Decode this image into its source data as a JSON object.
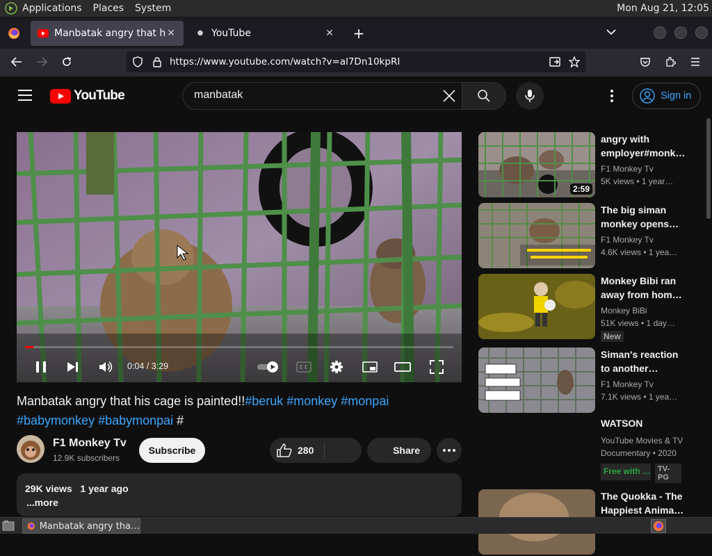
{
  "system_panel": {
    "menus": [
      "Applications",
      "Places",
      "System"
    ],
    "clock": "Mon Aug 21, 12:05"
  },
  "browser": {
    "tabs": [
      {
        "title": "Manbatak angry that his cage is painted",
        "active": true
      },
      {
        "title": "YouTube",
        "active": false
      }
    ],
    "url": "https://www.youtube.com/watch?v=al7Dn10kpRI"
  },
  "youtube": {
    "logo_text": "YouTube",
    "search_value": "manbatak",
    "sign_in_label": "Sign in",
    "player": {
      "current_time": "0:04",
      "duration": "3:29",
      "progress_fraction": 0.02
    },
    "video": {
      "title_plain": "Manbatak angry that his cage is painted!!",
      "hashtags_line1": "#beruk #monkey #monpai",
      "hashtags_line2": "#babymonkey #babymonpai",
      "title_trailing": "#",
      "channel_name": "F1 Monkey Tv",
      "subscribers": "12.9K subscribers",
      "subscribe_label": "Subscribe",
      "like_count": "280",
      "share_label": "Share",
      "views": "29K views",
      "age": "1 year ago",
      "more_label": "...more"
    },
    "recommendations": [
      {
        "title_line1": "angry with",
        "title_line2": "employer#monk…",
        "channel": "F1 Monkey Tv",
        "meta": "5K views  • 1 year…",
        "duration": "2:59",
        "badge": ""
      },
      {
        "title_line1": "The big siman",
        "title_line2": "monkey opens…",
        "channel": "F1 Monkey Tv",
        "meta": "4.6K views  • 1 yea…",
        "duration": "",
        "badge": ""
      },
      {
        "title_line1": "Monkey Bibi ran",
        "title_line2": "away from hom…",
        "channel": "Monkey BiBi",
        "meta": "51K views  • 1 day…",
        "duration": "",
        "badge": "New"
      },
      {
        "title_line1": "Siman's reaction",
        "title_line2": "to another…",
        "channel": "F1 Monkey Tv",
        "meta": "7.1K views  • 1 yea…",
        "duration": "",
        "badge": ""
      }
    ],
    "movie": {
      "title": "WATSON",
      "line1": "YouTube Movies & TV",
      "line2": "Documentary • 2020",
      "free_label": "Free with …",
      "rating": "TV-PG"
    },
    "last_rec": {
      "title_line1": "The Quokka - The",
      "title_line2": "Happiest Anima…"
    }
  },
  "taskbar": {
    "window_title": "Manbatak angry tha…"
  },
  "colors": {
    "youtube_red": "#ff0000",
    "link_blue": "#3ea6ff",
    "background": "#0f0f0f"
  }
}
